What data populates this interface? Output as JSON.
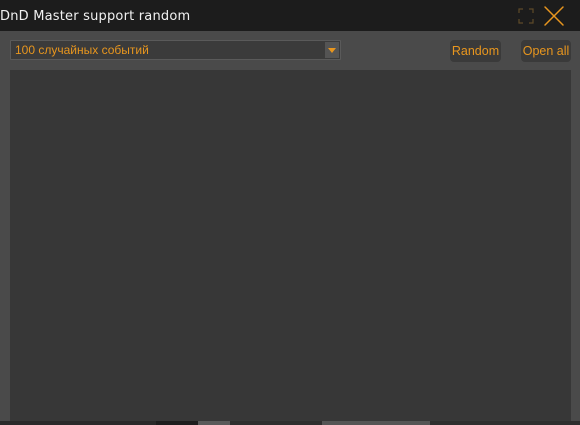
{
  "window": {
    "title": "DnD Master support random"
  },
  "titlebar_buttons": {
    "maximize_icon": "maximize-icon",
    "close_icon": "close-icon"
  },
  "toolbar": {
    "dropdown": {
      "selected": "100 случайных событий",
      "arrow_icon": "chevron-down-icon"
    },
    "random_label": "Random",
    "open_all_label": "Open all"
  },
  "colors": {
    "accent": "#e8961e",
    "titlebar_bg": "#1c1c1c",
    "window_bg": "#4a4a4a",
    "panel_bg": "#373737",
    "button_bg": "#3a3a3a"
  }
}
